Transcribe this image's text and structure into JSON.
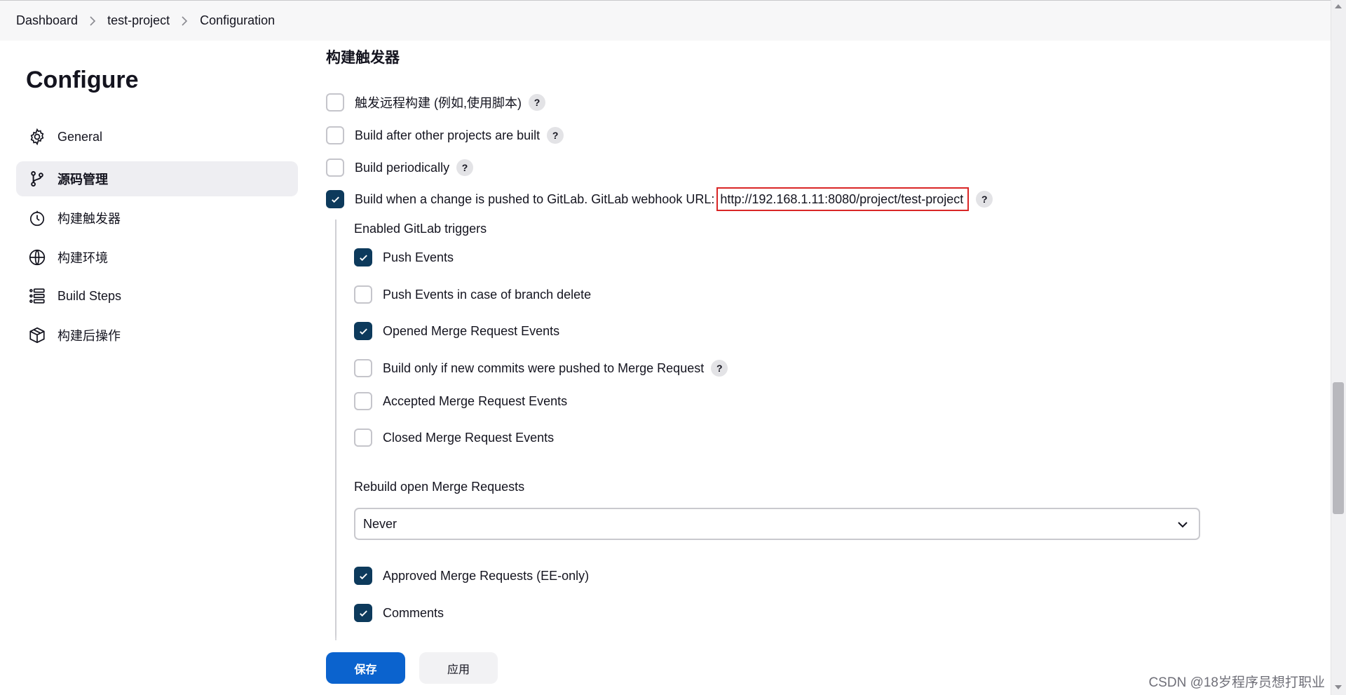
{
  "breadcrumb": [
    "Dashboard",
    "test-project",
    "Configuration"
  ],
  "sidebar": {
    "title": "Configure",
    "items": [
      {
        "label": "General",
        "icon": "gear-icon",
        "active": false
      },
      {
        "label": "源码管理",
        "icon": "git-branch-icon",
        "active": true
      },
      {
        "label": "构建触发器",
        "icon": "timer-icon",
        "active": false
      },
      {
        "label": "构建环境",
        "icon": "globe-icon",
        "active": false
      },
      {
        "label": "Build Steps",
        "icon": "list-steps-icon",
        "active": false
      },
      {
        "label": "构建后操作",
        "icon": "package-icon",
        "active": false
      }
    ]
  },
  "section_title": "构建触发器",
  "triggers": [
    {
      "label": "触发远程构建 (例如,使用脚本)",
      "checked": false
    },
    {
      "label": "Build after other projects are built",
      "checked": false
    },
    {
      "label": "Build periodically",
      "checked": false
    },
    {
      "label": "Build when a change is pushed to GitLab. GitLab webhook URL:",
      "checked": true,
      "url": "http://192.168.1.11:8080/project/test-project"
    }
  ],
  "gitlab": {
    "heading": "Enabled GitLab triggers",
    "options": [
      {
        "label": "Push Events",
        "checked": true
      },
      {
        "label": "Push Events in case of branch delete",
        "checked": false
      },
      {
        "label": "Opened Merge Request Events",
        "checked": true
      },
      {
        "label": "Build only if new commits were pushed to Merge Request",
        "checked": false
      },
      {
        "label": "Accepted Merge Request Events",
        "checked": false
      },
      {
        "label": "Closed Merge Request Events",
        "checked": false
      }
    ],
    "rebuild_label": "Rebuild open Merge Requests",
    "rebuild_value": "Never",
    "options2": [
      {
        "label": "Approved Merge Requests (EE-only)",
        "checked": true
      },
      {
        "label": "Comments",
        "checked": true
      }
    ]
  },
  "help_glyph": "?",
  "buttons": {
    "save": "保存",
    "apply": "应用"
  },
  "watermark": "CSDN @18岁程序员想打职业",
  "colors": {
    "accent": "#0b63ce",
    "checkbox_checked": "#0d3a5c",
    "highlight_border": "#d92626"
  }
}
